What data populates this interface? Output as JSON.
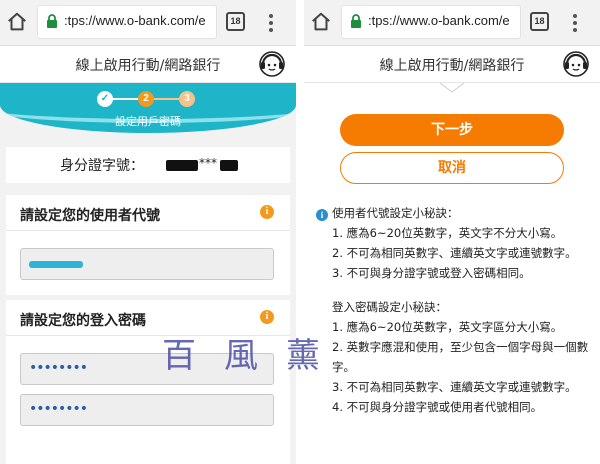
{
  "browser": {
    "url": ":tps://www.o-bank.com/e",
    "tabs_count": "18"
  },
  "header": {
    "title": "線上啟用行動/網路銀行"
  },
  "steps": {
    "labels": [
      "✓",
      "2",
      "3"
    ],
    "current_label": "設定用戶密碼"
  },
  "id_row": {
    "label": "身分證字號：",
    "masked": "***"
  },
  "user_id_card": {
    "title": "請設定您的使用者代號",
    "info_icon": "i"
  },
  "password_card": {
    "title": "請設定您的登入密碼",
    "info_icon": "i",
    "password_dots": "••••••••",
    "confirm_dots": "••••••••"
  },
  "actions": {
    "next": "下一步",
    "cancel": "取消"
  },
  "tips": {
    "icon": "i",
    "userid_title": "使用者代號設定小秘訣：",
    "userid_rules": [
      "1. 應為6~20位英數字，英文字不分大小寫。",
      "2. 不可為相同英數字、連續英文字或連號數字。",
      "3. 不可與身分證字號或登入密碼相同。"
    ],
    "password_title": "登入密碼設定小秘訣：",
    "password_rules": [
      "1. 應為6~20位英數字，英文字區分大小寫。",
      "2. 英數字應混和使用，至少包含一個字母與一個數字。",
      "3. 不可為相同英數字、連續英文字或連號數字。",
      "4. 不可與身分證字號或使用者代號相同。"
    ]
  },
  "watermark": "百風薰",
  "colors": {
    "accent": "#f57c00",
    "teal": "#1eb5c8",
    "step_orange": "#f39a1e",
    "info_blue": "#2b8fcf"
  }
}
